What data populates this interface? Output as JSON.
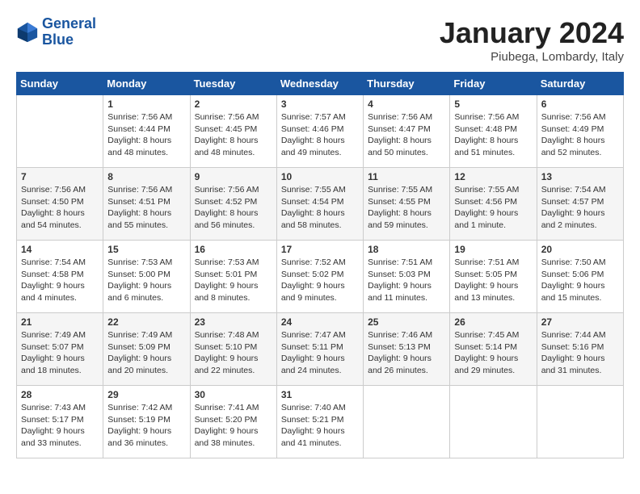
{
  "header": {
    "logo_line1": "General",
    "logo_line2": "Blue",
    "month_title": "January 2024",
    "location": "Piubega, Lombardy, Italy"
  },
  "days_of_week": [
    "Sunday",
    "Monday",
    "Tuesday",
    "Wednesday",
    "Thursday",
    "Friday",
    "Saturday"
  ],
  "weeks": [
    [
      {
        "day": "",
        "sunrise": "",
        "sunset": "",
        "daylight": ""
      },
      {
        "day": "1",
        "sunrise": "Sunrise: 7:56 AM",
        "sunset": "Sunset: 4:44 PM",
        "daylight": "Daylight: 8 hours and 48 minutes."
      },
      {
        "day": "2",
        "sunrise": "Sunrise: 7:56 AM",
        "sunset": "Sunset: 4:45 PM",
        "daylight": "Daylight: 8 hours and 48 minutes."
      },
      {
        "day": "3",
        "sunrise": "Sunrise: 7:57 AM",
        "sunset": "Sunset: 4:46 PM",
        "daylight": "Daylight: 8 hours and 49 minutes."
      },
      {
        "day": "4",
        "sunrise": "Sunrise: 7:56 AM",
        "sunset": "Sunset: 4:47 PM",
        "daylight": "Daylight: 8 hours and 50 minutes."
      },
      {
        "day": "5",
        "sunrise": "Sunrise: 7:56 AM",
        "sunset": "Sunset: 4:48 PM",
        "daylight": "Daylight: 8 hours and 51 minutes."
      },
      {
        "day": "6",
        "sunrise": "Sunrise: 7:56 AM",
        "sunset": "Sunset: 4:49 PM",
        "daylight": "Daylight: 8 hours and 52 minutes."
      }
    ],
    [
      {
        "day": "7",
        "sunrise": "Sunrise: 7:56 AM",
        "sunset": "Sunset: 4:50 PM",
        "daylight": "Daylight: 8 hours and 54 minutes."
      },
      {
        "day": "8",
        "sunrise": "Sunrise: 7:56 AM",
        "sunset": "Sunset: 4:51 PM",
        "daylight": "Daylight: 8 hours and 55 minutes."
      },
      {
        "day": "9",
        "sunrise": "Sunrise: 7:56 AM",
        "sunset": "Sunset: 4:52 PM",
        "daylight": "Daylight: 8 hours and 56 minutes."
      },
      {
        "day": "10",
        "sunrise": "Sunrise: 7:55 AM",
        "sunset": "Sunset: 4:54 PM",
        "daylight": "Daylight: 8 hours and 58 minutes."
      },
      {
        "day": "11",
        "sunrise": "Sunrise: 7:55 AM",
        "sunset": "Sunset: 4:55 PM",
        "daylight": "Daylight: 8 hours and 59 minutes."
      },
      {
        "day": "12",
        "sunrise": "Sunrise: 7:55 AM",
        "sunset": "Sunset: 4:56 PM",
        "daylight": "Daylight: 9 hours and 1 minute."
      },
      {
        "day": "13",
        "sunrise": "Sunrise: 7:54 AM",
        "sunset": "Sunset: 4:57 PM",
        "daylight": "Daylight: 9 hours and 2 minutes."
      }
    ],
    [
      {
        "day": "14",
        "sunrise": "Sunrise: 7:54 AM",
        "sunset": "Sunset: 4:58 PM",
        "daylight": "Daylight: 9 hours and 4 minutes."
      },
      {
        "day": "15",
        "sunrise": "Sunrise: 7:53 AM",
        "sunset": "Sunset: 5:00 PM",
        "daylight": "Daylight: 9 hours and 6 minutes."
      },
      {
        "day": "16",
        "sunrise": "Sunrise: 7:53 AM",
        "sunset": "Sunset: 5:01 PM",
        "daylight": "Daylight: 9 hours and 8 minutes."
      },
      {
        "day": "17",
        "sunrise": "Sunrise: 7:52 AM",
        "sunset": "Sunset: 5:02 PM",
        "daylight": "Daylight: 9 hours and 9 minutes."
      },
      {
        "day": "18",
        "sunrise": "Sunrise: 7:51 AM",
        "sunset": "Sunset: 5:03 PM",
        "daylight": "Daylight: 9 hours and 11 minutes."
      },
      {
        "day": "19",
        "sunrise": "Sunrise: 7:51 AM",
        "sunset": "Sunset: 5:05 PM",
        "daylight": "Daylight: 9 hours and 13 minutes."
      },
      {
        "day": "20",
        "sunrise": "Sunrise: 7:50 AM",
        "sunset": "Sunset: 5:06 PM",
        "daylight": "Daylight: 9 hours and 15 minutes."
      }
    ],
    [
      {
        "day": "21",
        "sunrise": "Sunrise: 7:49 AM",
        "sunset": "Sunset: 5:07 PM",
        "daylight": "Daylight: 9 hours and 18 minutes."
      },
      {
        "day": "22",
        "sunrise": "Sunrise: 7:49 AM",
        "sunset": "Sunset: 5:09 PM",
        "daylight": "Daylight: 9 hours and 20 minutes."
      },
      {
        "day": "23",
        "sunrise": "Sunrise: 7:48 AM",
        "sunset": "Sunset: 5:10 PM",
        "daylight": "Daylight: 9 hours and 22 minutes."
      },
      {
        "day": "24",
        "sunrise": "Sunrise: 7:47 AM",
        "sunset": "Sunset: 5:11 PM",
        "daylight": "Daylight: 9 hours and 24 minutes."
      },
      {
        "day": "25",
        "sunrise": "Sunrise: 7:46 AM",
        "sunset": "Sunset: 5:13 PM",
        "daylight": "Daylight: 9 hours and 26 minutes."
      },
      {
        "day": "26",
        "sunrise": "Sunrise: 7:45 AM",
        "sunset": "Sunset: 5:14 PM",
        "daylight": "Daylight: 9 hours and 29 minutes."
      },
      {
        "day": "27",
        "sunrise": "Sunrise: 7:44 AM",
        "sunset": "Sunset: 5:16 PM",
        "daylight": "Daylight: 9 hours and 31 minutes."
      }
    ],
    [
      {
        "day": "28",
        "sunrise": "Sunrise: 7:43 AM",
        "sunset": "Sunset: 5:17 PM",
        "daylight": "Daylight: 9 hours and 33 minutes."
      },
      {
        "day": "29",
        "sunrise": "Sunrise: 7:42 AM",
        "sunset": "Sunset: 5:19 PM",
        "daylight": "Daylight: 9 hours and 36 minutes."
      },
      {
        "day": "30",
        "sunrise": "Sunrise: 7:41 AM",
        "sunset": "Sunset: 5:20 PM",
        "daylight": "Daylight: 9 hours and 38 minutes."
      },
      {
        "day": "31",
        "sunrise": "Sunrise: 7:40 AM",
        "sunset": "Sunset: 5:21 PM",
        "daylight": "Daylight: 9 hours and 41 minutes."
      },
      {
        "day": "",
        "sunrise": "",
        "sunset": "",
        "daylight": ""
      },
      {
        "day": "",
        "sunrise": "",
        "sunset": "",
        "daylight": ""
      },
      {
        "day": "",
        "sunrise": "",
        "sunset": "",
        "daylight": ""
      }
    ]
  ]
}
